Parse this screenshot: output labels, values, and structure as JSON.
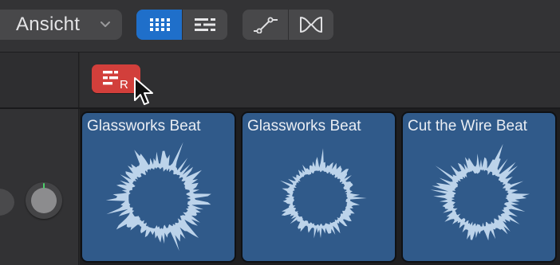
{
  "toolbar": {
    "view_menu_label": "Ansicht",
    "view_modes": [
      {
        "icon": "grid-icon",
        "active": true
      },
      {
        "icon": "list-icon",
        "active": false
      }
    ],
    "curve_tools": [
      {
        "icon": "automation-curve-icon"
      },
      {
        "icon": "crossfade-icon"
      }
    ]
  },
  "header": {
    "repeat_button": {
      "icon": "list-repeat-icon",
      "letter": "R",
      "color": "#d23f3b"
    }
  },
  "cells": [
    {
      "title": "Glassworks Beat"
    },
    {
      "title": "Glassworks Beat"
    },
    {
      "title": "Cut the Wire Beat"
    }
  ],
  "colors": {
    "accent": "#1f6fca",
    "cell_bg": "#305a8a",
    "waveform": "#bcd3ea",
    "knob_indicator": "#4ccf6a"
  }
}
